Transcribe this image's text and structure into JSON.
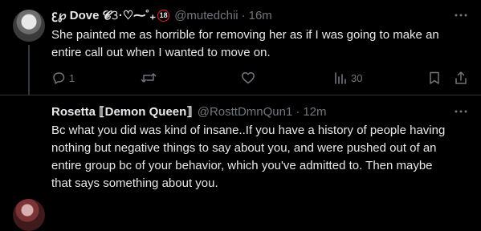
{
  "tweets": [
    {
      "display_name": "ꜫ℘ Dove 𝓒𝟹·♡⁓˚₊ ",
      "badge": "18",
      "handle": "@mutedchii",
      "time": "16m",
      "text": "She painted me as horrible for removing her as if I was going to make an\nentire call out when I wanted to move on.",
      "replies": "1",
      "retweets": "",
      "likes": "",
      "views": "30"
    },
    {
      "display_name": "Rosetta ⟦Demon Queen⟧",
      "handle": "@RosttDmnQun1",
      "time": "12m",
      "text": "Bc what you did was kind of insane..If you have a history of people having\nnothing but negative things to say about you, and were pushed out of an\nentire group bc of your behavior, which you've admitted to. Then maybe\nthat says something about you."
    }
  ],
  "icons": {
    "reply": "reply-icon",
    "retweet": "retweet-icon",
    "like": "heart-icon",
    "views": "views-icon",
    "bookmark": "bookmark-icon",
    "share": "share-icon",
    "more": "more-icon"
  },
  "colors": {
    "background": "#000000",
    "text": "#e7e9ea",
    "muted": "#71767b",
    "badge": "#f4212e"
  }
}
